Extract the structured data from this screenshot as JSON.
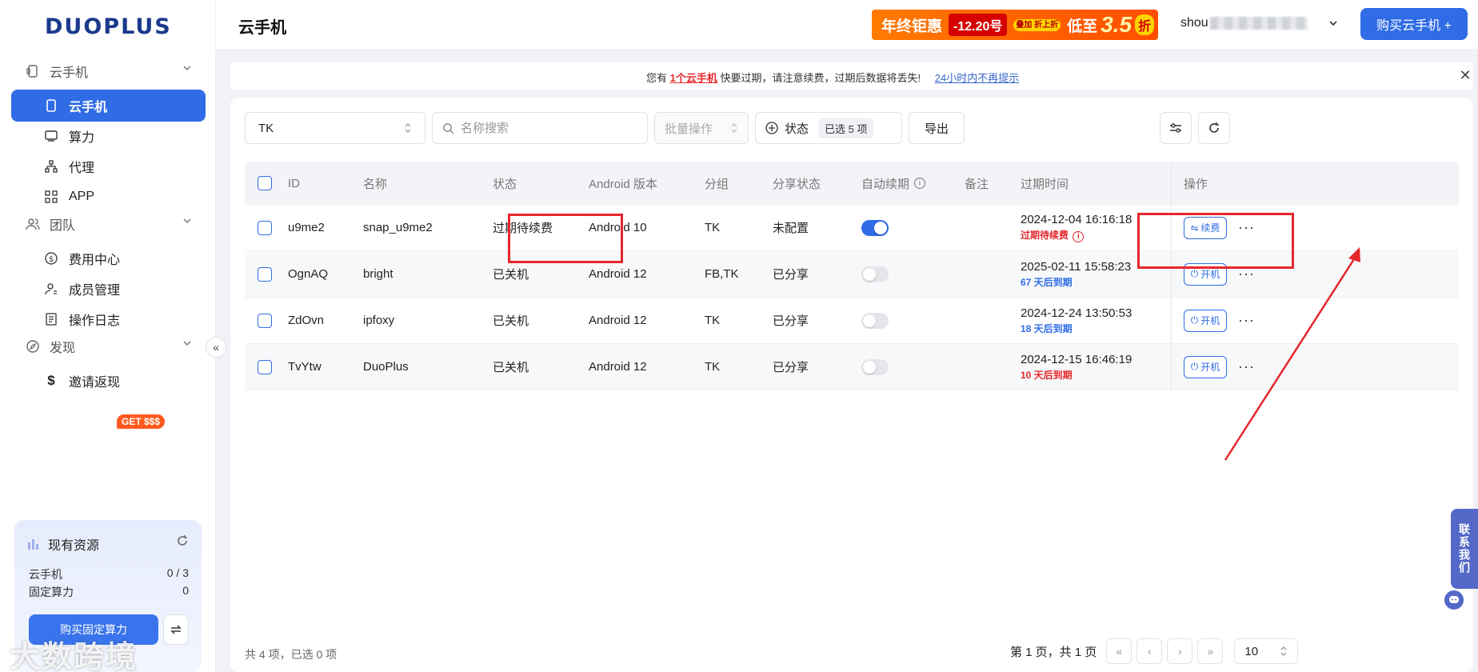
{
  "app": {
    "logo": "DUOPLUS",
    "page_title": "云手机"
  },
  "colors": {
    "accent": "#2f6ce5",
    "danger": "#e5272c",
    "promo": "#ff6a00"
  },
  "sidebar": {
    "groups": {
      "cloud_phone": "云手机",
      "team": "团队",
      "discover": "发现"
    },
    "items": {
      "cloud_phone": "云手机",
      "compute": "算力",
      "proxy": "代理",
      "app": "APP",
      "billing": "费用中心",
      "members": "成员管理",
      "logs": "操作日志",
      "invite": "邀请返现"
    },
    "invite_badge": "GET $$$",
    "resources": {
      "title": "现有资源",
      "rows": [
        {
          "label": "云手机",
          "value": "0 / 3"
        },
        {
          "label": "固定算力",
          "value": "0"
        }
      ],
      "buy_button": "购买固定算力"
    },
    "watermark": "大数跨境"
  },
  "header": {
    "promo": {
      "part1": "年终钜惠",
      "part2": "-12.20号",
      "part3": "叠加 折上折",
      "part4": "低至",
      "part5": "3.5",
      "part6": "折"
    },
    "user": "shou",
    "buy_button": "购买云手机 +"
  },
  "notice": {
    "prefix": "您有",
    "link": "1个云手机",
    "suffix": "快要过期，请注意续费，过期后数据将丢失!",
    "dismiss": "24小时内不再提示"
  },
  "toolbar": {
    "group_select": "TK",
    "search_placeholder": "名称搜索",
    "batch": "批量操作",
    "status_label": "状态",
    "status_selected": "已选 5 项",
    "export": "导出"
  },
  "table": {
    "columns": {
      "id": "ID",
      "name": "名称",
      "status": "状态",
      "android": "Android 版本",
      "group": "分组",
      "share": "分享状态",
      "auto_renew": "自动续期",
      "remark": "备注",
      "expire": "过期时间",
      "ops": "操作"
    },
    "rows": [
      {
        "id": "u9me2",
        "name": "snap_u9me2",
        "status": "过期待续费",
        "android": "Android 10",
        "group": "TK",
        "share": "未配置",
        "auto_renew": true,
        "expire": "2024-12-04 16:16:18",
        "expire_note": "过期待续费",
        "action": "续费"
      },
      {
        "id": "OgnAQ",
        "name": "bright",
        "status": "已关机",
        "android": "Android 12",
        "group": "FB,TK",
        "share": "已分享",
        "auto_renew": false,
        "expire": "2025-02-11 15:58:23",
        "expire_note": "67 天后到期",
        "action": "开机"
      },
      {
        "id": "ZdOvn",
        "name": "ipfoxy",
        "status": "已关机",
        "android": "Android 12",
        "group": "TK",
        "share": "已分享",
        "auto_renew": false,
        "expire": "2024-12-24 13:50:53",
        "expire_note": "18 天后到期",
        "action": "开机"
      },
      {
        "id": "TvYtw",
        "name": "DuoPlus",
        "status": "已关机",
        "android": "Android 12",
        "group": "TK",
        "share": "已分享",
        "auto_renew": false,
        "expire": "2024-12-15 16:46:19",
        "expire_note": "10 天后到期",
        "action": "开机"
      }
    ]
  },
  "footer": {
    "total": "共 4 项，已选 0 项",
    "page_info": "第 1 页，共 1 页",
    "page_size": "10"
  },
  "contact": "联系我们"
}
